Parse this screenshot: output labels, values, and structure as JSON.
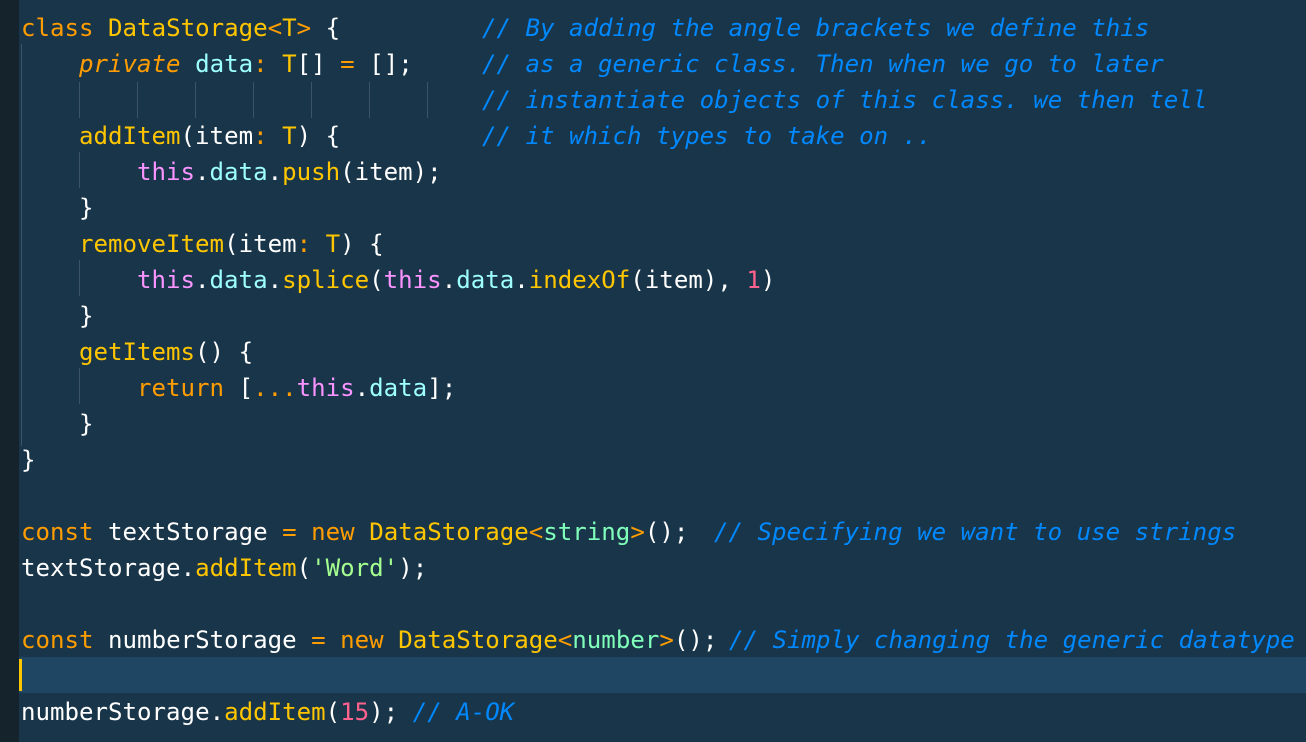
{
  "editor": {
    "colors": {
      "background": "#193549",
      "keyword": "#ff9d00",
      "class_name": "#ffc600",
      "property": "#9effff",
      "this": "#fb94ff",
      "number": "#ff628c",
      "string": "#a5ff90",
      "comment": "#0088ff",
      "cursor": "#ffc600",
      "active_line": "#1f4662"
    },
    "code": {
      "l1_kw": "class",
      "l1_name": "DataStorage",
      "l1_generic_open": "<",
      "l1_generic_t": "T",
      "l1_generic_close": ">",
      "l1_brace": "{",
      "l1_comment": "// By adding the angle brackets we define this",
      "l2_kw": "private",
      "l2_prop": "data",
      "l2_colon": ":",
      "l2_type": "T",
      "l2_arr": "[]",
      "l2_eq": "=",
      "l2_val": "[];",
      "l2_comment": "// as a generic class. Then when we go to later",
      "l3_comment": "// instantiate objects of this class. we then tell",
      "l4_fn": "addItem",
      "l4_params_open": "(item",
      "l4_colon": ":",
      "l4_type": "T",
      "l4_params_close": ") {",
      "l4_comment": "// it which types to take on ..",
      "l5_this": "this",
      "l5_dot1": ".",
      "l5_prop": "data",
      "l5_dot2": ".",
      "l5_method": "push",
      "l5_rest": "(item);",
      "l6_brace": "}",
      "l7_fn": "removeItem",
      "l7_params_open": "(item",
      "l7_colon": ":",
      "l7_type": "T",
      "l7_params_close": ") {",
      "l8_this1": "this",
      "l8_dot1": ".",
      "l8_prop1": "data",
      "l8_dot2": ".",
      "l8_method1": "splice",
      "l8_paren": "(",
      "l8_this2": "this",
      "l8_dot3": ".",
      "l8_prop2": "data",
      "l8_dot4": ".",
      "l8_method2": "indexOf",
      "l8_args": "(item), ",
      "l8_num": "1",
      "l8_close": ")",
      "l9_brace": "}",
      "l10_fn": "getItems",
      "l10_rest": "() {",
      "l11_kw": "return",
      "l11_open": "[",
      "l11_spread": "...",
      "l11_this": "this",
      "l11_dot": ".",
      "l11_prop": "data",
      "l11_close": "];",
      "l12_brace": "}",
      "l13_brace": "}",
      "l15_kw": "const",
      "l15_var": "textStorage",
      "l15_eq": "=",
      "l15_new": "new",
      "l15_cls": "DataStorage",
      "l15_lt": "<",
      "l15_type": "string",
      "l15_gt": ">",
      "l15_end": "();",
      "l15_comment": "// Specifying we want to use strings",
      "l16_var": "textStorage",
      "l16_dot": ".",
      "l16_method": "addItem",
      "l16_open": "(",
      "l16_str": "'Word'",
      "l16_close": ");",
      "l18_kw": "const",
      "l18_var": "numberStorage",
      "l18_eq": "=",
      "l18_new": "new",
      "l18_cls": "DataStorage",
      "l18_lt": "<",
      "l18_type": "number",
      "l18_gt": ">",
      "l18_end": "();",
      "l18_comment": "// Simply changing the generic datatype",
      "l20_var": "numberStorage",
      "l20_dot": ".",
      "l20_method": "addItem",
      "l20_open": "(",
      "l20_num": "15",
      "l20_close": ");",
      "l20_comment": "// A-OK"
    }
  }
}
